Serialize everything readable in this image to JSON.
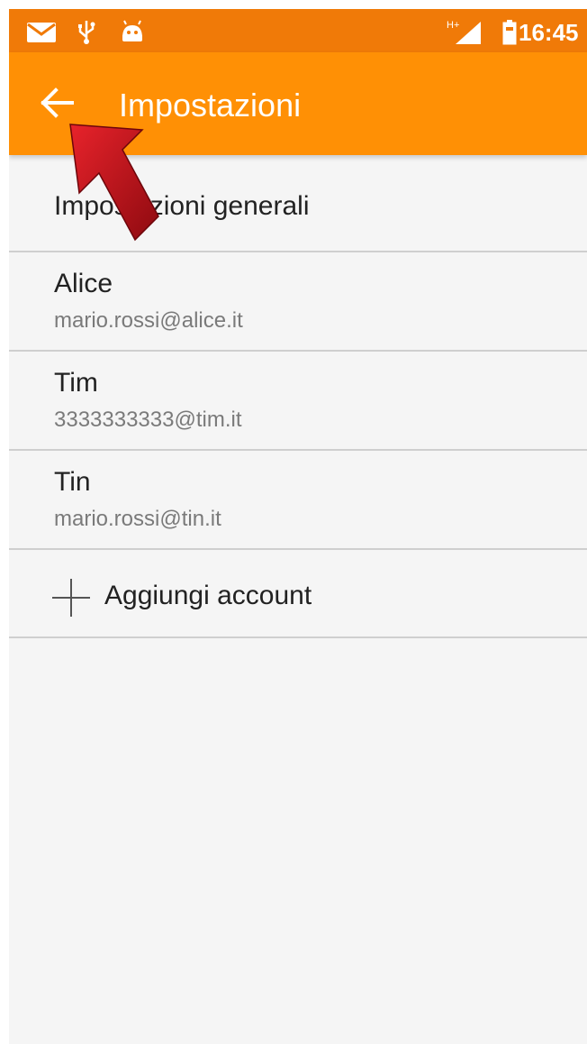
{
  "status_bar": {
    "time": "16:45",
    "network": "H+",
    "icons": [
      "mail-icon",
      "usb-icon",
      "android-icon",
      "signal-icon",
      "battery-icon"
    ]
  },
  "toolbar": {
    "back_icon": "arrow-back-icon",
    "title": "Impostazioni"
  },
  "general_settings": {
    "label": "Impostazioni generali"
  },
  "accounts": [
    {
      "name": "Alice",
      "email": "mario.rossi@alice.it"
    },
    {
      "name": "Tim",
      "email": "3333333333@tim.it"
    },
    {
      "name": "Tin",
      "email": "mario.rossi@tin.it"
    }
  ],
  "add_account": {
    "icon": "plus-icon",
    "label": "Aggiungi account"
  },
  "colors": {
    "status_bar": "#f07a08",
    "toolbar": "#ff9005",
    "background": "#f5f5f5",
    "annotation_arrow": "#c8101a"
  }
}
